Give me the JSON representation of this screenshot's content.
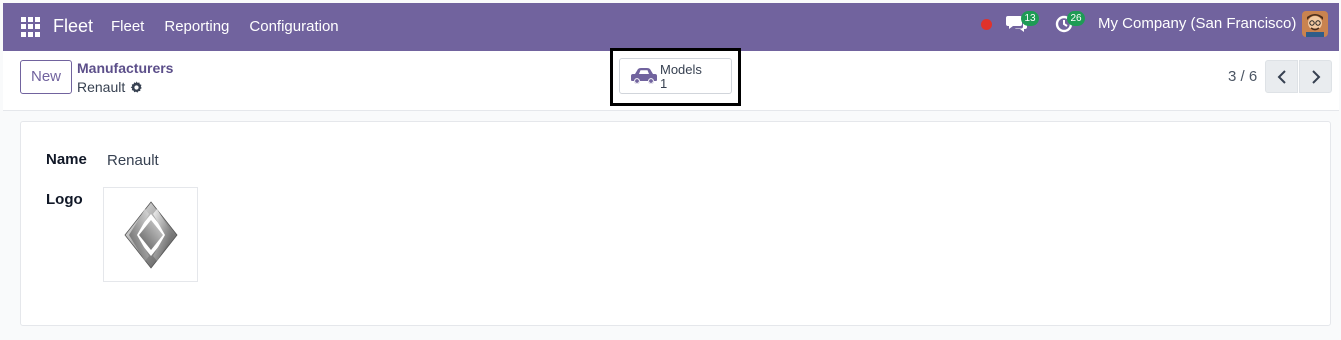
{
  "navbar": {
    "app_name": "Fleet",
    "menu": [
      "Fleet",
      "Reporting",
      "Configuration"
    ],
    "chat_count": "13",
    "activity_count": "26",
    "company": "My Company (San Francisco)",
    "color": "#71639e"
  },
  "control": {
    "new_label": "New",
    "breadcrumb_parent": "Manufacturers",
    "breadcrumb_current": "Renault",
    "smart_button": {
      "label": "Models",
      "value": "1",
      "icon": "car-icon"
    },
    "pager": "3 / 6"
  },
  "form": {
    "name_label": "Name",
    "name_value": "Renault",
    "logo_label": "Logo"
  }
}
